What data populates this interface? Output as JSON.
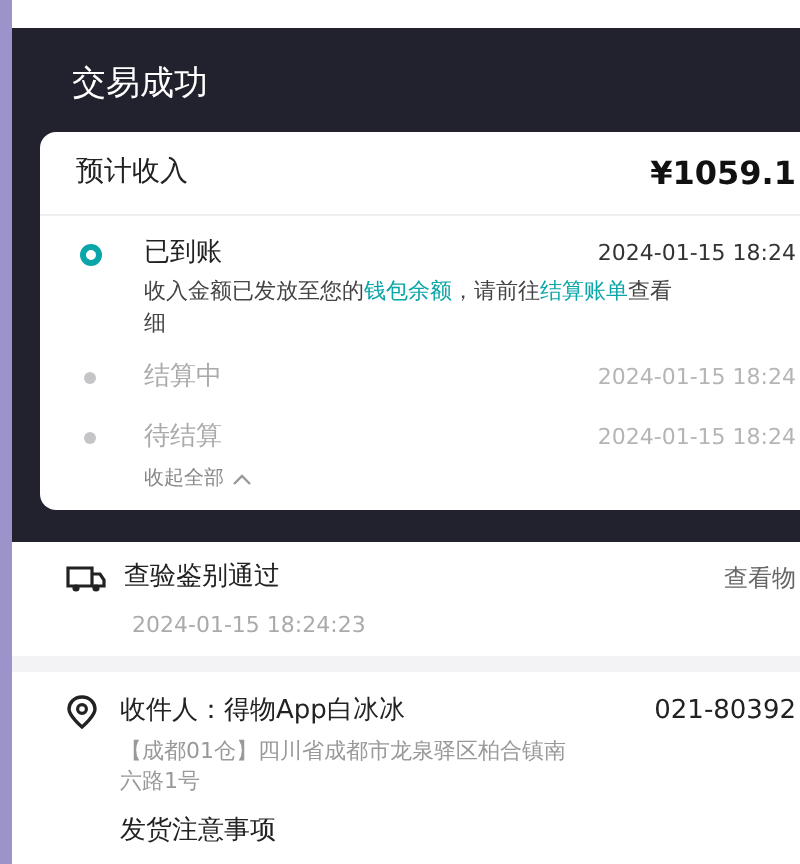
{
  "header": {
    "title": "交易成功"
  },
  "income": {
    "label": "预计收入",
    "amount": "¥1059.1",
    "timeline": [
      {
        "label": "已到账",
        "time": "2024-01-15 18:24",
        "active": true,
        "note": [
          {
            "text": "收入金额已发放至您的",
            "link": false
          },
          {
            "text": "钱包余额",
            "link": true
          },
          {
            "text": "，请前往",
            "link": false
          },
          {
            "text": "结算账单",
            "link": true
          },
          {
            "text": "查看",
            "link": false
          }
        ],
        "note_tail": "细"
      },
      {
        "label": "结算中",
        "time": "2024-01-15 18:24",
        "active": false
      },
      {
        "label": "待结算",
        "time": "2024-01-15 18:24",
        "active": false
      }
    ],
    "collapse": "收起全部"
  },
  "logistics": {
    "status": "查验鉴别通过",
    "time": "2024-01-15 18:24:23",
    "link": "查看物"
  },
  "address": {
    "recipient": "收件人：得物App白冰冰",
    "phone": "021-80392",
    "address": "【成都01仓】四川省成都市龙泉驿区柏合镇南六路1号"
  },
  "notice": {
    "title": "发货注意事项"
  }
}
